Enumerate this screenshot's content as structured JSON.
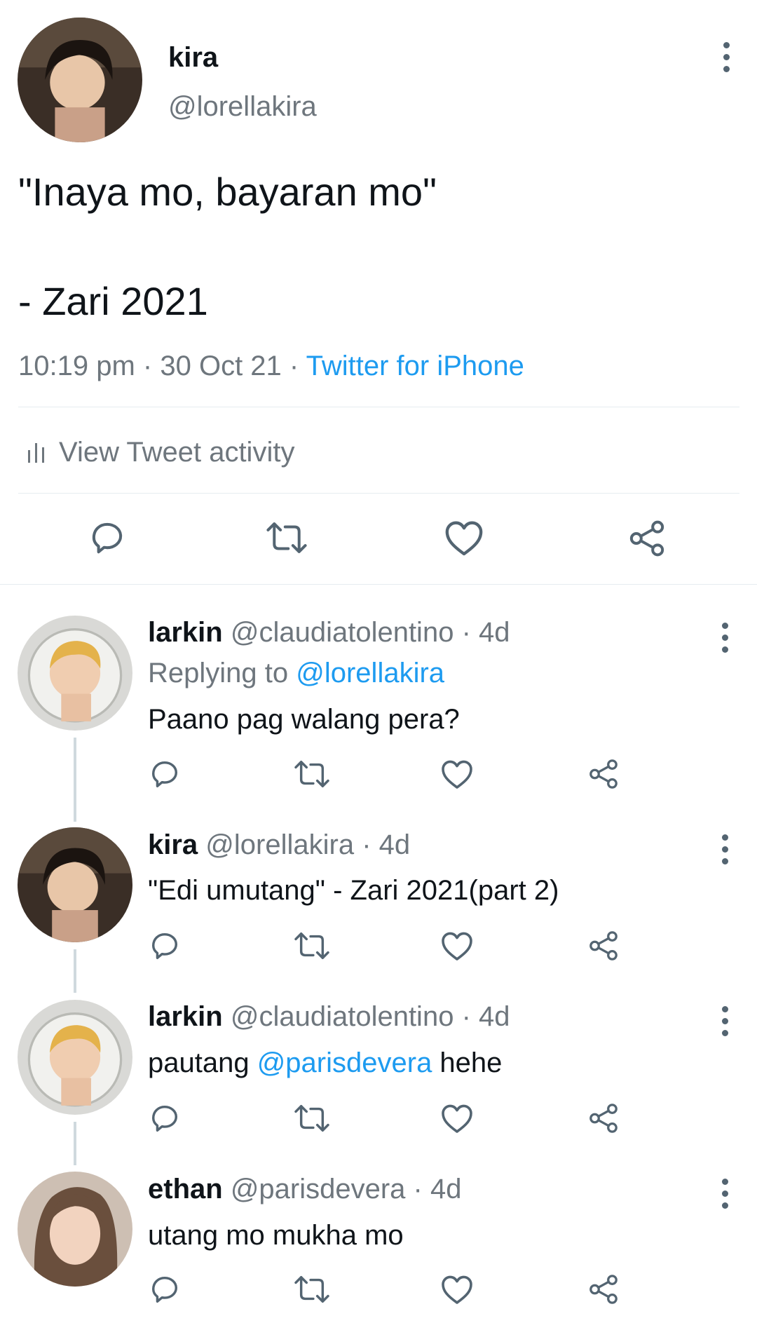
{
  "main_tweet": {
    "name": "kira",
    "handle": "@lorellakira",
    "text_line1": "\"Inaya mo, bayaran mo\"",
    "text_line2": "- Zari 2021",
    "time": "10:19 pm",
    "sep1": "·",
    "date": "30 Oct 21",
    "sep2": "·",
    "source": "Twitter for iPhone",
    "activity_label": "View Tweet activity"
  },
  "replies": [
    {
      "name": "larkin",
      "handle": "@claudiatolentino",
      "dot": "·",
      "age": "4d",
      "replying_prefix": "Replying to",
      "replying_to": "@lorellakira",
      "text": "Paano pag walang pera?"
    },
    {
      "name": "kira",
      "handle": "@lorellakira",
      "dot": "·",
      "age": "4d",
      "text": "\"Edi umutang\" - Zari 2021(part 2)"
    },
    {
      "name": "larkin",
      "handle": "@claudiatolentino",
      "dot": "·",
      "age": "4d",
      "text_before": "pautang ",
      "mention": "@parisdevera",
      "text_after": " hehe"
    },
    {
      "name": "ethan",
      "handle": "@parisdevera",
      "dot": "·",
      "age": "4d",
      "text": "utang mo mukha mo"
    }
  ],
  "icons": {
    "reply": "reply-icon",
    "retweet": "retweet-icon",
    "like": "heart-icon",
    "share": "share-icon",
    "more": "more-vertical-icon",
    "activity": "bar-chart-icon"
  },
  "colors": {
    "link": "#1d9bf0",
    "secondary_text": "#6e767d",
    "icon": "#536471",
    "thread_line": "#cfd9de",
    "divider": "#e6ecf0"
  }
}
